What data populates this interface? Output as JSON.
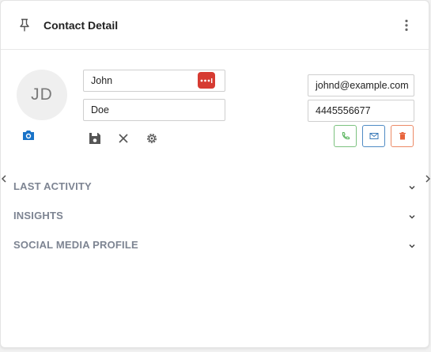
{
  "header": {
    "title": "Contact Detail",
    "pin_icon": "pin-icon",
    "menu_icon": "more-vertical-icon"
  },
  "avatar": {
    "initials": "JD",
    "photo_icon": "camera-icon"
  },
  "form": {
    "first_name": "John",
    "last_name": "Doe",
    "password_manager_icon": "password-manager-icon",
    "email": "johnd@example.com",
    "phone": "4445556677"
  },
  "toolbar": {
    "save_icon": "save-icon",
    "cancel_icon": "close-icon",
    "settings_icon": "gear-icon"
  },
  "actions": {
    "call_icon": "phone-icon",
    "email_icon": "mail-icon",
    "delete_icon": "trash-icon"
  },
  "sections": [
    {
      "label": "LAST ACTIVITY"
    },
    {
      "label": "INSIGHTS"
    },
    {
      "label": "SOCIAL MEDIA PROFILE"
    }
  ],
  "colors": {
    "accent": "#1a73c8",
    "call": "#4caf50",
    "email": "#3a7ab8",
    "delete": "#e8643c",
    "password_badge": "#d63b32",
    "section_text": "#7d8492"
  }
}
